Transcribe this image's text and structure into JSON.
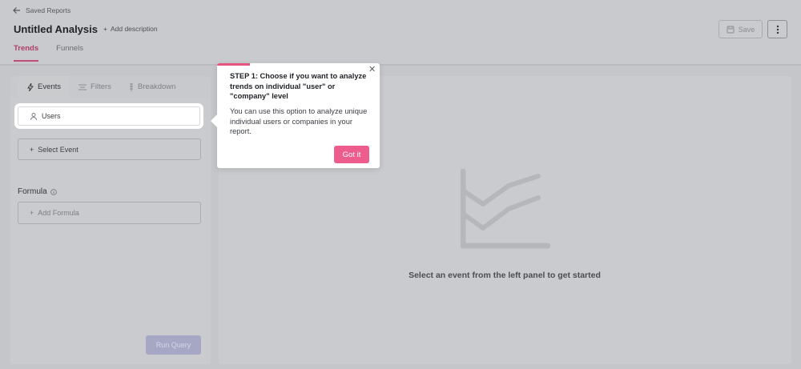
{
  "header": {
    "back_label": "Saved Reports",
    "title": "Untitled Analysis",
    "add_description_label": "Add description",
    "save_label": "Save",
    "tabs": [
      {
        "label": "Trends",
        "active": true
      },
      {
        "label": "Funnels",
        "active": false
      }
    ]
  },
  "left_panel": {
    "tabs": [
      {
        "label": "Events",
        "icon": "lightning-icon",
        "active": true
      },
      {
        "label": "Filters",
        "icon": "filter-icon",
        "active": false
      },
      {
        "label": "Breakdown",
        "icon": "breakdown-icon",
        "active": false
      }
    ],
    "level_select_value": "Users",
    "select_event_label": "Select Event",
    "formula_label": "Formula",
    "add_formula_label": "Add Formula",
    "run_query_label": "Run Query"
  },
  "main": {
    "empty_state_text": "Select an event from the left panel to get started"
  },
  "tooltip": {
    "title": "STEP 1: Choose if you want to analyze trends on individual \"user\" or \"company\" level",
    "body": "You can use this option to analyze unique individual users or companies in your report.",
    "button_label": "Got it",
    "progress_fraction": 0.2
  },
  "colors": {
    "accent": "#c24d76",
    "primary_button": "#ec5c8c",
    "run_query_disabled": "#a6a7c4"
  }
}
